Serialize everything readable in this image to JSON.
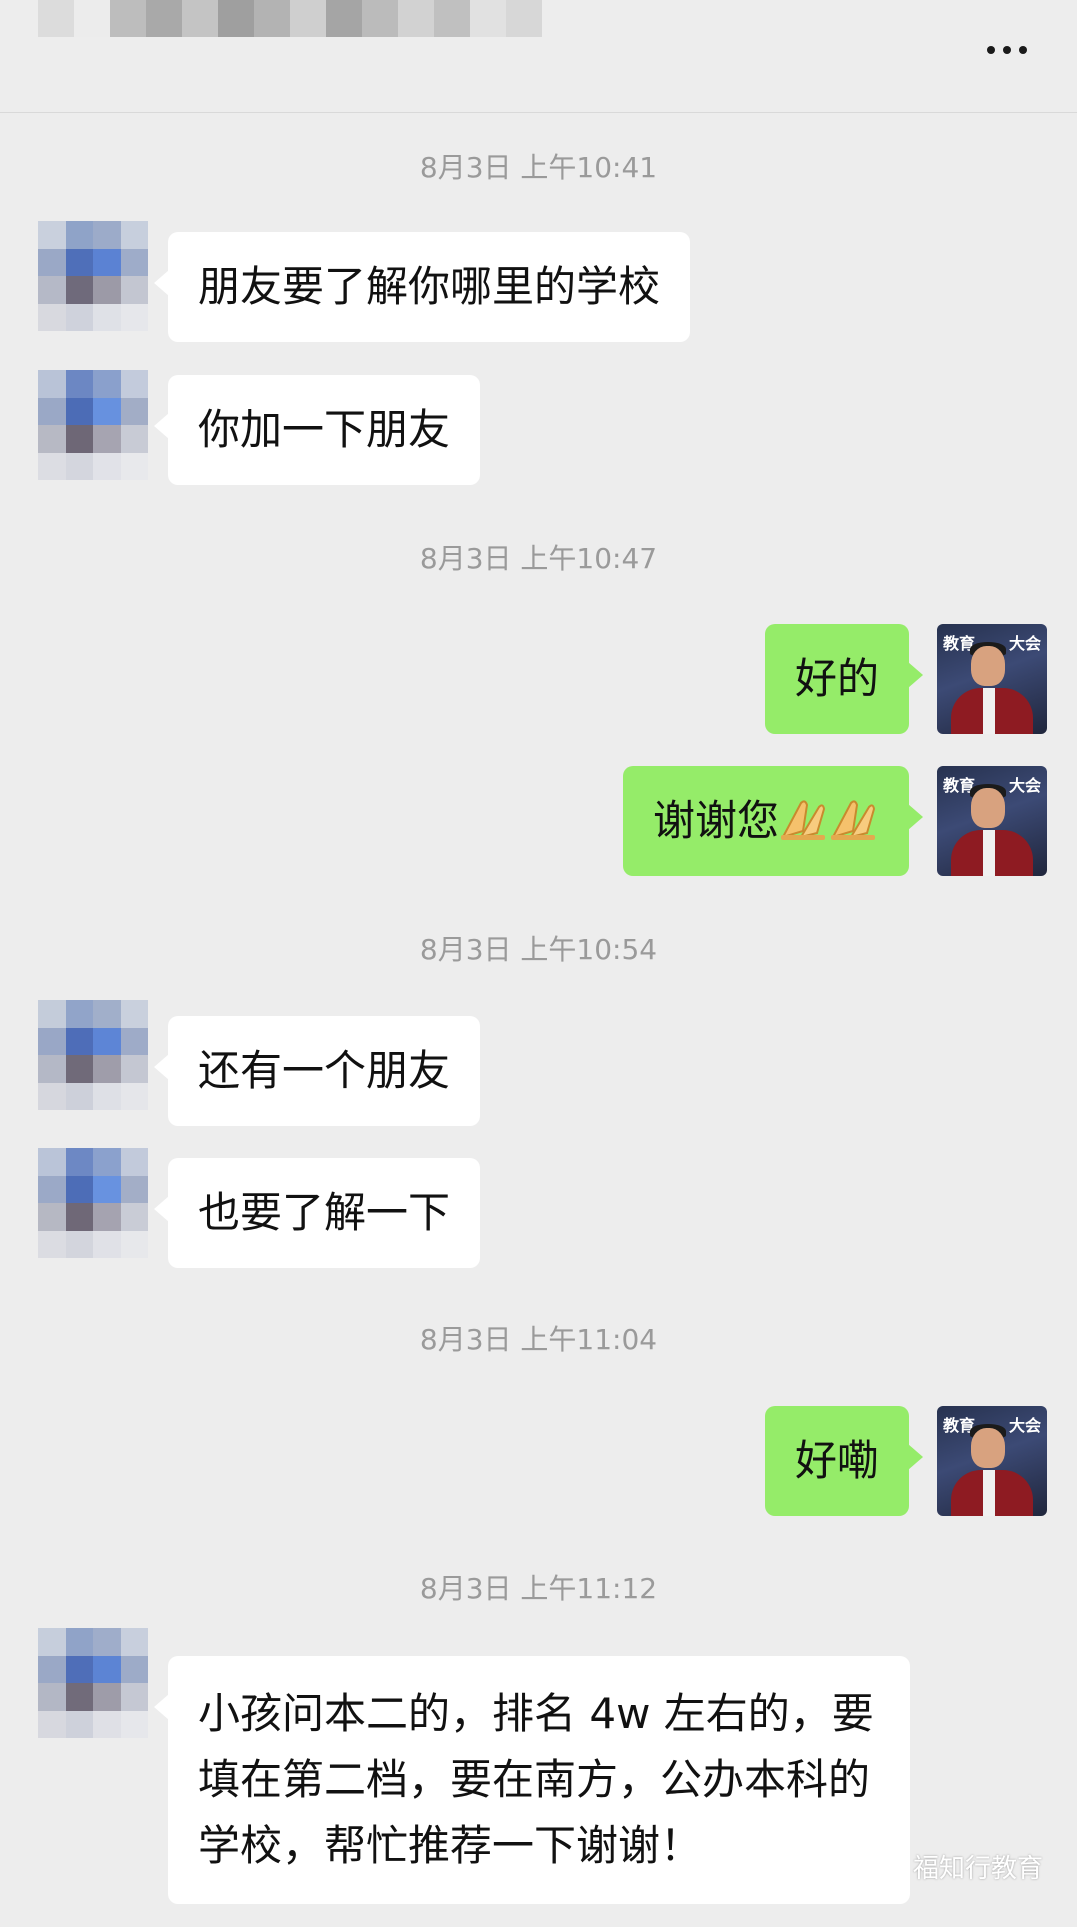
{
  "header": {
    "more_icon": "more-dots-icon"
  },
  "messages": [
    {
      "type": "timestamp",
      "text": "8月3日 上午10:41"
    },
    {
      "type": "in",
      "text": "朋友要了解你哪里的学校"
    },
    {
      "type": "in",
      "text": "你加一下朋友"
    },
    {
      "type": "timestamp",
      "text": "8月3日 上午10:47"
    },
    {
      "type": "out",
      "text": "好的"
    },
    {
      "type": "out",
      "text": "谢谢您",
      "emoji": "praying-hands-icon"
    },
    {
      "type": "timestamp",
      "text": "8月3日 上午10:54"
    },
    {
      "type": "in",
      "text": "还有一个朋友"
    },
    {
      "type": "in",
      "text": "也要了解一下"
    },
    {
      "type": "timestamp",
      "text": "8月3日 上午11:04"
    },
    {
      "type": "out",
      "text": "好嘞"
    },
    {
      "type": "timestamp",
      "text": "8月3日 上午11:12"
    },
    {
      "type": "in",
      "text": "小孩问本二的，排名 4w 左右的，要填在第二档，要在南方，公办本科的学校，帮忙推荐一下谢谢！"
    }
  ],
  "watermark": {
    "text": "福知行教育",
    "icon": "wechat-icon"
  },
  "colors": {
    "background": "#ededed",
    "outgoing_bubble": "#95ec69",
    "incoming_bubble": "#ffffff",
    "timestamp_text": "#9a9a9a"
  }
}
